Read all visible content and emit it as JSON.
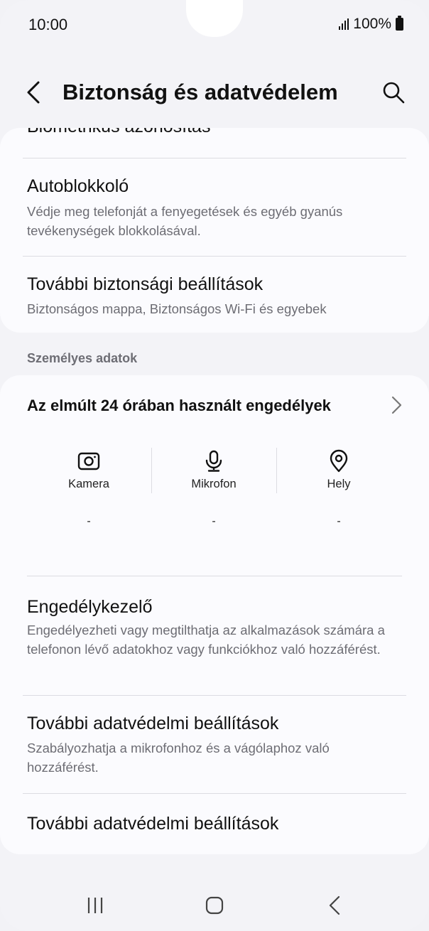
{
  "status_bar": {
    "time": "10:00",
    "battery": "100%"
  },
  "header": {
    "title": "Biztonság és adatvédelem"
  },
  "security_card": {
    "clipped_item": "Biometrikus azonosítás",
    "items": [
      {
        "title": "Autoblokkoló",
        "subtitle": "Védje meg telefonját a fenyegetések és egyéb gyanús tevékenységek blokkolásával."
      },
      {
        "title": "További biztonsági beállítások",
        "subtitle": "Biztonságos mappa, Biztonságos Wi-Fi és egyebek"
      }
    ]
  },
  "section_label": "Személyes adatok",
  "privacy_card": {
    "permissions_header": "Az elmúlt 24 órában használt engedélyek",
    "permissions": [
      {
        "label": "Kamera",
        "icon": "camera-icon",
        "value": "-"
      },
      {
        "label": "Mikrofon",
        "icon": "microphone-icon",
        "value": "-"
      },
      {
        "label": "Hely",
        "icon": "location-icon",
        "value": "-"
      }
    ],
    "items": [
      {
        "title": "Engedélykezelő",
        "subtitle": "Engedélyezheti vagy megtilthatja az alkalmazások számára a telefonon lévő adatokhoz vagy funkciókhoz való hozzáférést."
      },
      {
        "title": "További adatvédelmi beállítások",
        "subtitle": "Szabályozhatja a mikrofonhoz és a vágólaphoz való hozzáférést."
      },
      {
        "title": "További adatvédelmi beállítások",
        "subtitle": ""
      }
    ]
  },
  "nav_bar": {
    "items": [
      "recents-icon",
      "home-icon",
      "back-icon"
    ]
  }
}
